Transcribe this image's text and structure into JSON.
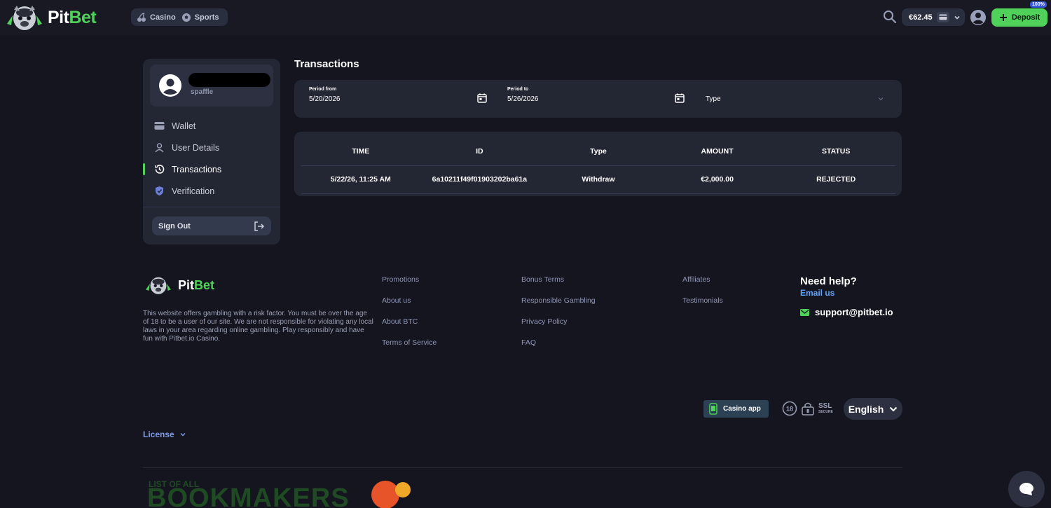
{
  "header": {
    "brand_part1": "Pit",
    "brand_part2": "Bet",
    "nav": [
      {
        "label": "Casino",
        "icon": "cherries-icon"
      },
      {
        "label": "Sports",
        "icon": "soccer-ball-icon"
      }
    ],
    "balance": "€62.45",
    "deposit_label": "Deposit",
    "badge": "100%"
  },
  "sidebar": {
    "username": "spaffle",
    "items": [
      {
        "label": "Wallet",
        "icon": "wallet-icon"
      },
      {
        "label": "User Details",
        "icon": "user-icon"
      },
      {
        "label": "Transactions",
        "icon": "history-icon",
        "active": true
      },
      {
        "label": "Verification",
        "icon": "shield-check-icon"
      }
    ],
    "sign_out": "Sign Out"
  },
  "main": {
    "title": "Transactions",
    "filters": {
      "period_from_label": "Period from",
      "period_from_value": "5/20/2026",
      "period_to_label": "Period to",
      "period_to_value": "5/26/2026",
      "type_label": "Type"
    },
    "table": {
      "columns": [
        "TIME",
        "ID",
        "Type",
        "AMOUNT",
        "STATUS"
      ],
      "rows": [
        [
          "5/22/26, 11:25 AM",
          "6a10211f49f01903202ba61a",
          "Withdraw",
          "€2,000.00",
          "REJECTED"
        ]
      ]
    }
  },
  "footer": {
    "brand_part1": "Pit",
    "brand_part2": "Bet",
    "disclaimer": "This website offers gambling with a risk factor. You must be over the age of 18 to be a user of our site. We are not responsible for violating any local laws in your area regarding online gambling. Play responsibly and have fun with Pitbet.io Casino.",
    "links_col1": [
      "Promotions",
      "About us",
      "About BTC",
      "Terms of Service"
    ],
    "links_col2": [
      "Bonus Terms",
      "Responsible Gambling",
      "Privacy Policy",
      "FAQ"
    ],
    "links_col3": [
      "Affiliates",
      "Testimonials"
    ],
    "help_title": "Need help?",
    "help_sub": "Email us",
    "email": "support@pitbet.io",
    "casino_app": "Casino app",
    "age_badge": "18",
    "ssl_line1": "SSL",
    "ssl_line2": "SECURE",
    "language": "English",
    "license": "License",
    "bookmakers_small": "LIST OF ALL",
    "bookmakers_big": "BOOKMAKERS"
  },
  "colors": {
    "background": "#15151f",
    "panel": "#232633",
    "accent": "#4fd15a",
    "link": "#8f96b6"
  }
}
